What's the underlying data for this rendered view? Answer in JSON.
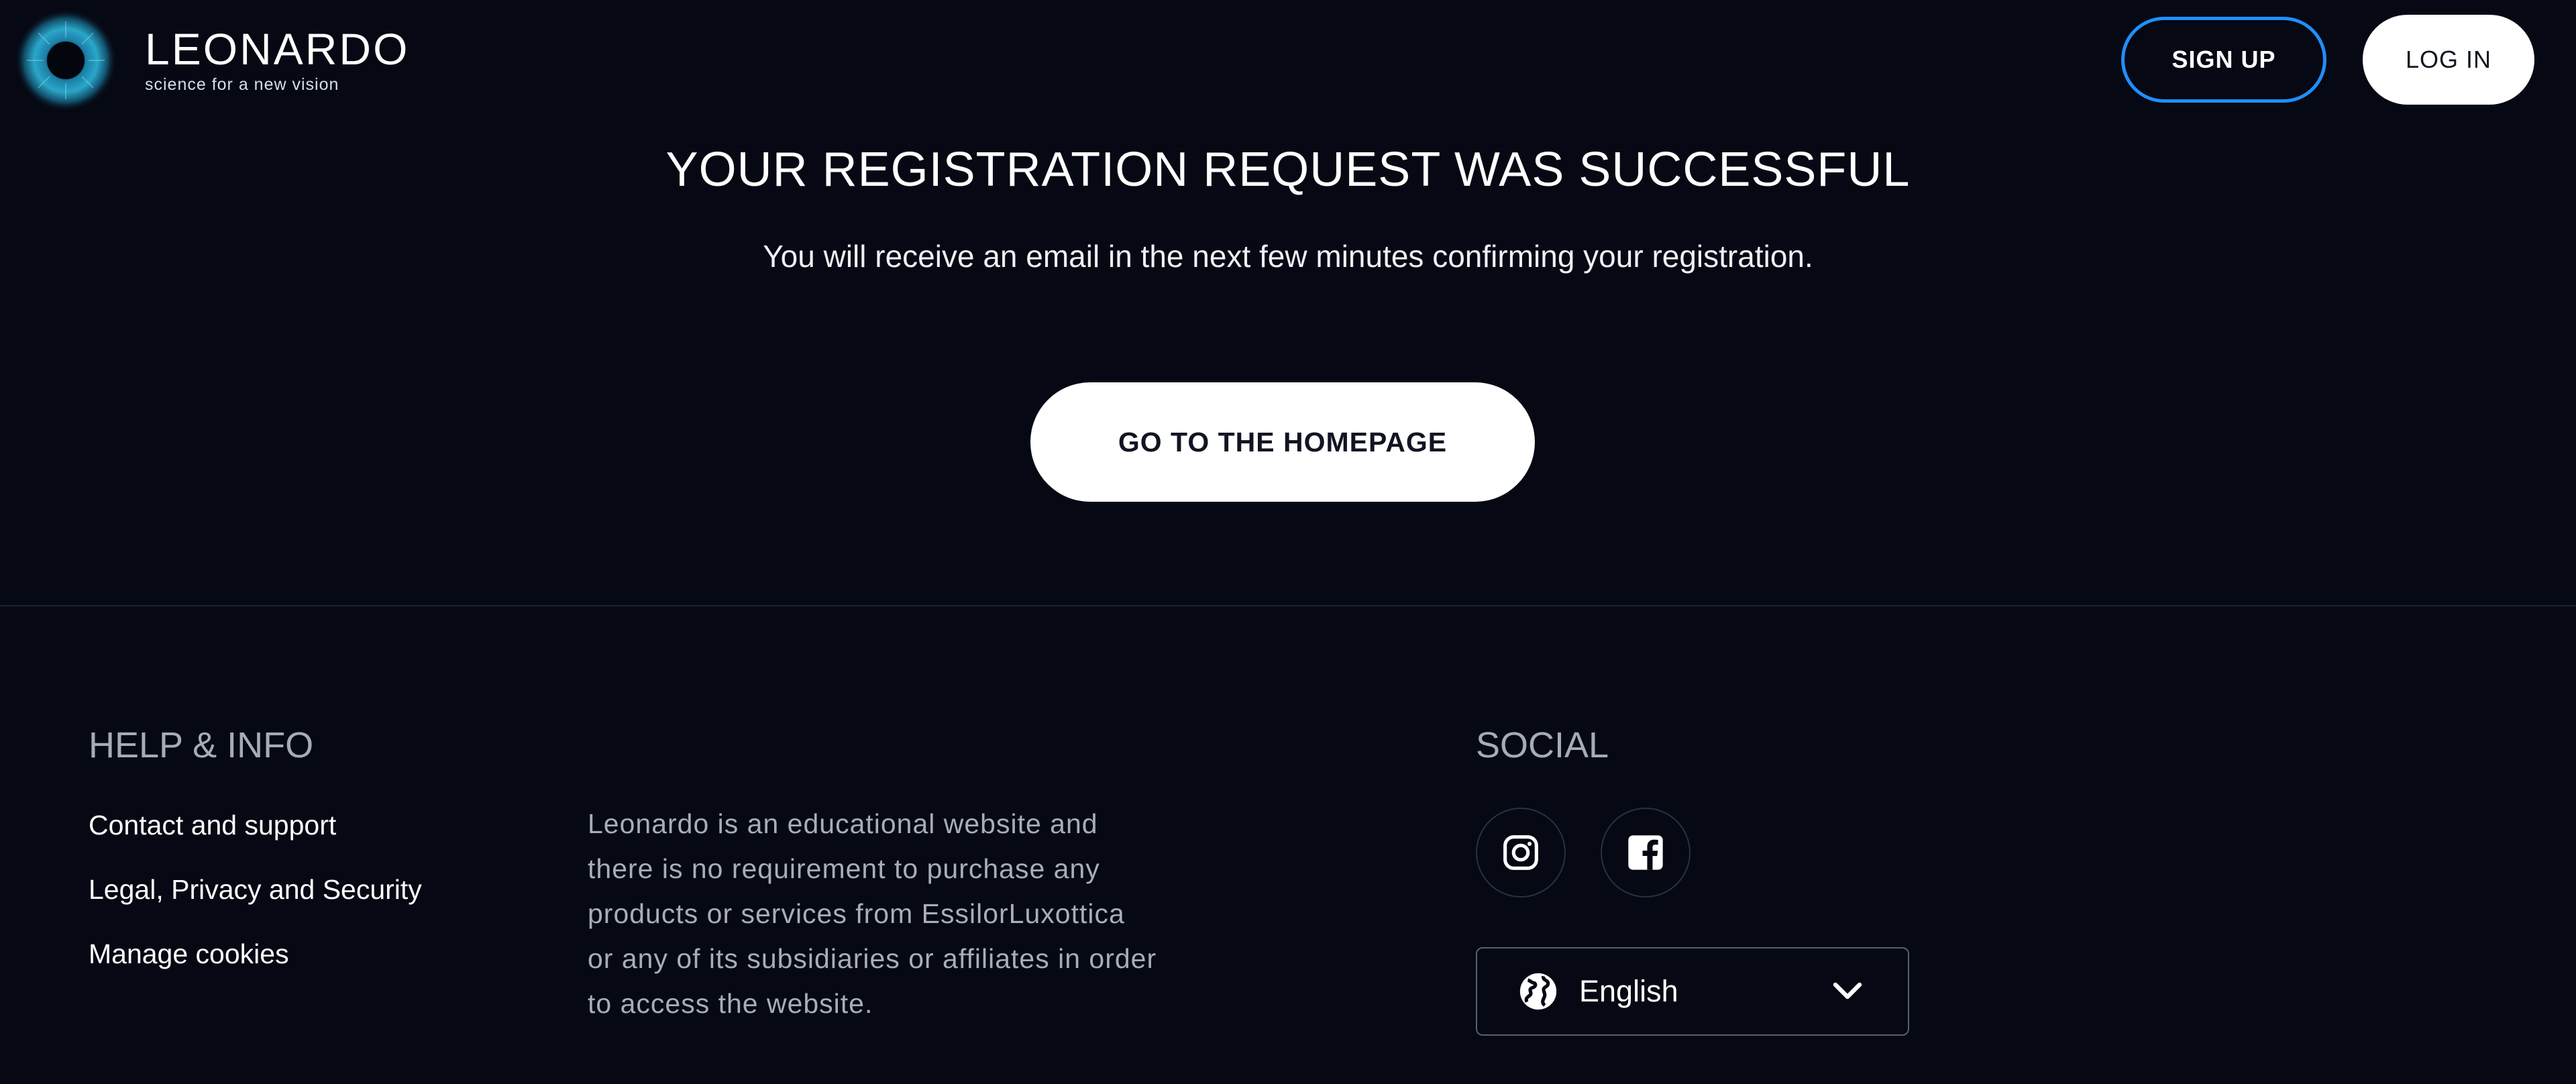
{
  "header": {
    "brand_name": "LEONARDO",
    "brand_tagline": "science for a new vision",
    "signup_label": "SIGN UP",
    "login_label": "LOG IN"
  },
  "main": {
    "title": "YOUR REGISTRATION REQUEST WAS SUCCESSFUL",
    "subtitle": "You will receive an email in the next few minutes confirming your registration.",
    "home_button_label": "GO TO THE HOMEPAGE"
  },
  "footer": {
    "help_heading": "HELP & INFO",
    "help_links": [
      "Contact and support",
      "Legal, Privacy and Security",
      "Manage cookies"
    ],
    "disclaimer": "Leonardo is an educational website and there is no requirement to purchase any products or services from EssilorLuxottica or any of its subsidiaries or affiliates in order to access the website.",
    "social_heading": "SOCIAL",
    "social_icons": [
      "instagram-icon",
      "facebook-icon"
    ],
    "language_selected": "English"
  },
  "colors": {
    "background": "#060914",
    "signup_border": "#1f8fff",
    "heading_gray": "#a6abb6"
  }
}
